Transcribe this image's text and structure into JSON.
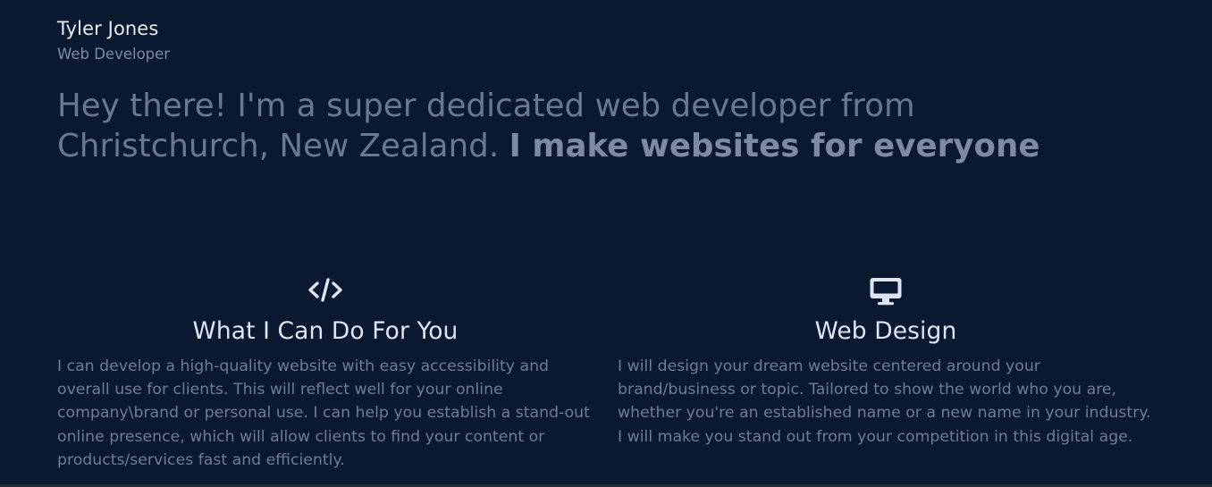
{
  "header": {
    "name": "Tyler Jones",
    "role": "Web Developer"
  },
  "intro": {
    "text": "Hey there! I'm a super dedicated web developer from Christchurch, New Zealand. ",
    "emphasis": "I make websites for everyone"
  },
  "services": [
    {
      "icon": "code-icon",
      "title": "What I Can Do For You",
      "text": "I can develop a high-quality website with easy accessibility and overall use for clients. This will reflect well for your online company\\brand or personal use. I can help you establish a stand-out online presence, which will allow clients to find your content or products/services fast and efficiently."
    },
    {
      "icon": "desktop-icon",
      "title": "Web Design",
      "text": "I will design your dream website centered around your brand/business or topic. Tailored to show the world who you are, whether you're an established name or a new name in your industry. I will make you stand out from your competition in this digital age."
    }
  ],
  "colors": {
    "background": "#0b1930",
    "heading": "#e6ebf5",
    "muted": "#6b7891",
    "icon": "#dde4f3"
  }
}
